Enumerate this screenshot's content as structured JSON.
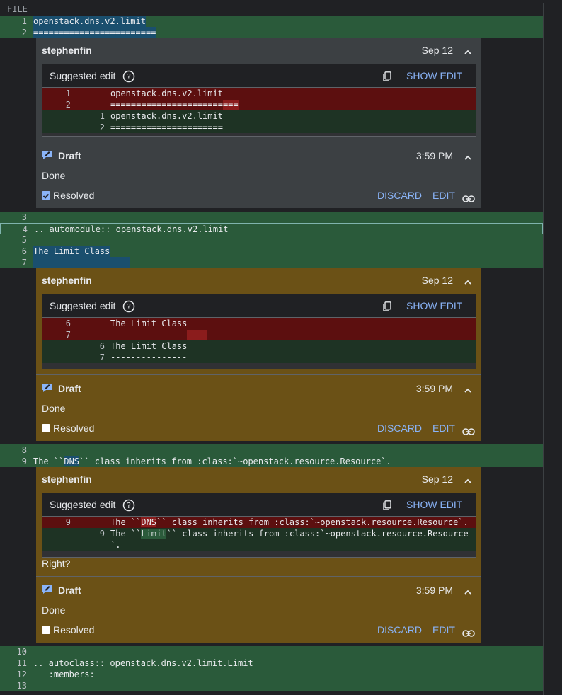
{
  "file_label": "FILE",
  "lines": [
    {
      "n": "1",
      "text": "openstack.dns.v2.limit"
    },
    {
      "n": "2",
      "text": "========================"
    },
    {
      "n": "3",
      "text": ""
    },
    {
      "n": "4",
      "text": ".. automodule:: openstack.dns.v2.limit"
    },
    {
      "n": "5",
      "text": ""
    },
    {
      "n": "6",
      "text": "The Limit Class"
    },
    {
      "n": "7",
      "text": "-------------------"
    },
    {
      "n": "8",
      "text": ""
    },
    {
      "n": "9",
      "text": "The ``DNS`` class inherits from :class:`~openstack.resource.Resource`."
    },
    {
      "n": "10",
      "text": ""
    },
    {
      "n": "11",
      "text": ".. autoclass:: openstack.dns.v2.limit.Limit"
    },
    {
      "n": "12",
      "text": "   :members:"
    },
    {
      "n": "13",
      "text": ""
    }
  ],
  "comments": [
    {
      "author": "stephenfin",
      "date": "Sep 12",
      "suggest_title": "Suggested edit",
      "show_edit": "SHOW EDIT",
      "diff": [
        {
          "old": "1",
          "new": "",
          "text": "openstack.dns.v2.limit"
        },
        {
          "old": "2",
          "new": "",
          "pre": "======================",
          "hl": "===",
          "post": ""
        },
        {
          "old": "",
          "new": "1",
          "text": "openstack.dns.v2.limit"
        },
        {
          "old": "",
          "new": "2",
          "text": "======================"
        }
      ],
      "extra": "",
      "draft_label": "Draft",
      "draft_time": "3:59 PM",
      "draft_body": "Done",
      "resolved_label": "Resolved",
      "resolved": true,
      "discard": "DISCARD",
      "edit": "EDIT"
    },
    {
      "author": "stephenfin",
      "date": "Sep 12",
      "suggest_title": "Suggested edit",
      "show_edit": "SHOW EDIT",
      "diff": [
        {
          "old": "6",
          "new": "",
          "text": "The Limit Class"
        },
        {
          "old": "7",
          "new": "",
          "pre": "---------------",
          "hl": "----",
          "post": ""
        },
        {
          "old": "",
          "new": "6",
          "text": "The Limit Class"
        },
        {
          "old": "",
          "new": "7",
          "text": "---------------"
        }
      ],
      "extra": "",
      "draft_label": "Draft",
      "draft_time": "3:59 PM",
      "draft_body": "Done",
      "resolved_label": "Resolved",
      "resolved": false,
      "discard": "DISCARD",
      "edit": "EDIT"
    },
    {
      "author": "stephenfin",
      "date": "Sep 12",
      "suggest_title": "Suggested edit",
      "show_edit": "SHOW EDIT",
      "diff": [
        {
          "old": "9",
          "new": "",
          "pre": "The ``",
          "hl": "DNS",
          "post": "`` class inherits from :class:`~openstack.resource.Resource`."
        },
        {
          "old": "",
          "new": "9",
          "pre": "The ``",
          "hl": "Limit",
          "post": "`` class inherits from :class:`~openstack.resource.Resource"
        },
        {
          "old": "",
          "new": "",
          "text": "`."
        }
      ],
      "extra": "Right?",
      "draft_label": "Draft",
      "draft_time": "3:59 PM",
      "draft_body": "Done",
      "resolved_label": "Resolved",
      "resolved": false,
      "discard": "DISCARD",
      "edit": "EDIT"
    }
  ],
  "icons": {
    "help": "help-circle-icon",
    "copy": "copy-icon",
    "chevron": "chevron-up-icon",
    "draft": "draft-edit-icon",
    "link": "link-icon"
  },
  "colors": {
    "accent": "#8ab4f8",
    "added_bg": "#2a5a3a",
    "comment_gold": "#6b5116",
    "comment_gray": "#3c4043"
  }
}
